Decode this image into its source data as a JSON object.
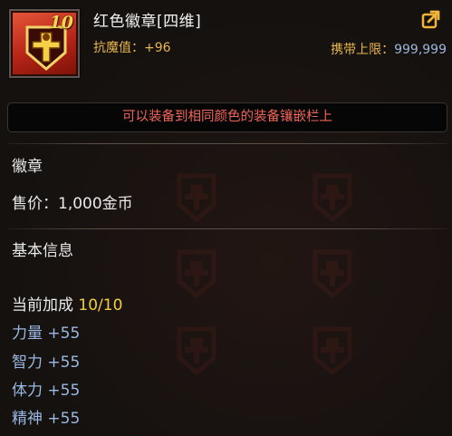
{
  "item": {
    "name": "红色徽章[四维]",
    "level": "10",
    "resist_label": "抗魔值：",
    "resist_value": "+96",
    "carry_label": "携带上限：",
    "carry_value": "999,999",
    "notice": "可以装备到相同颜色的装备镶嵌栏上"
  },
  "info": {
    "category": "徽章",
    "price_label": "售价：",
    "price_value": "1,000金币",
    "section_title": "基本信息",
    "bonus_label": "当前加成",
    "bonus_value": "10/10"
  },
  "stats": [
    {
      "name": "力量",
      "value": "+55"
    },
    {
      "name": "智力",
      "value": "+55"
    },
    {
      "name": "体力",
      "value": "+55"
    },
    {
      "name": "精神",
      "value": "+55"
    }
  ],
  "icons": {
    "item": "red-badge-emblem-icon",
    "share": "share-arrow-icon"
  },
  "colors": {
    "notice_text": "#f0655a",
    "gold_text": "#e8b64c",
    "stat_text": "#9bb8e2",
    "badge_red": "#b52416"
  }
}
